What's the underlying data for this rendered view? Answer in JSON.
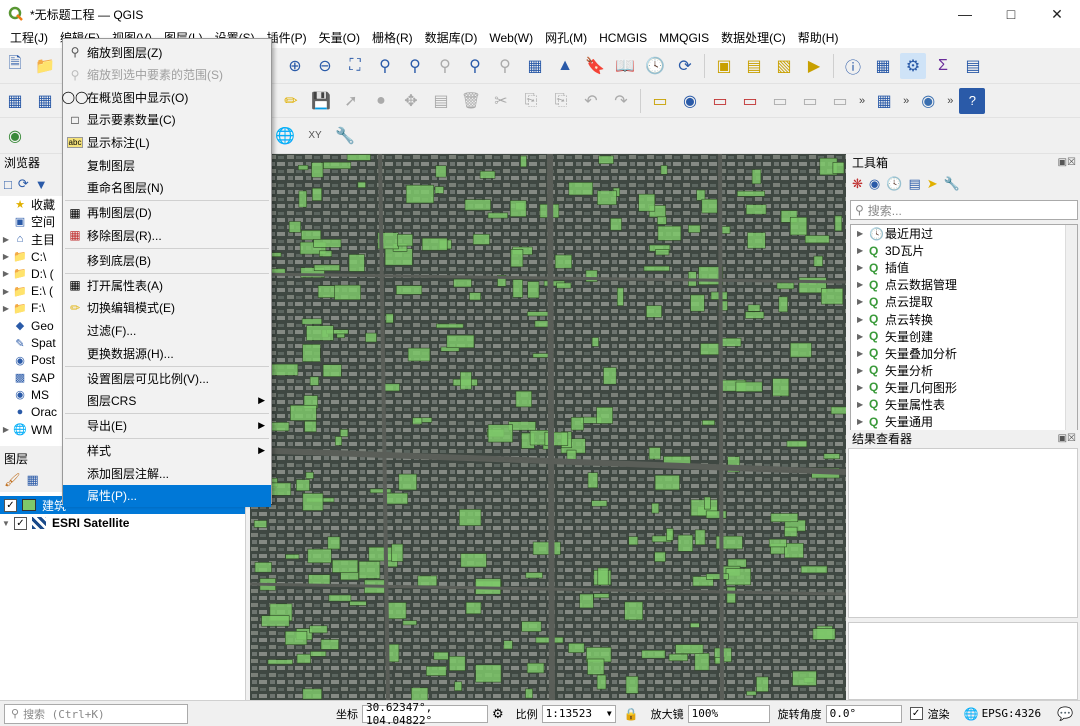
{
  "window": {
    "title": "*无标题工程 — QGIS"
  },
  "menubar": [
    "工程(J)",
    "编辑(E)",
    "视图(V)",
    "图层(L)",
    "设置(S)",
    "插件(P)",
    "矢量(O)",
    "栅格(R)",
    "数据库(D)",
    "Web(W)",
    "网孔(M)",
    "HCMGIS",
    "MMQGIS",
    "数据处理(C)",
    "帮助(H)"
  ],
  "browser": {
    "title": "浏览器",
    "items": [
      {
        "label": "收藏",
        "icon": "star-icon"
      },
      {
        "label": "空间",
        "icon": "bookmark-icon"
      },
      {
        "label": "主目",
        "icon": "home-icon"
      },
      {
        "label": "C:\\",
        "icon": "folder-icon"
      },
      {
        "label": "D:\\ (",
        "icon": "folder-icon"
      },
      {
        "label": "E:\\ (",
        "icon": "folder-icon"
      },
      {
        "label": "F:\\",
        "icon": "folder-icon"
      },
      {
        "label": "Geo",
        "icon": "geopackage-icon"
      },
      {
        "label": "Spat",
        "icon": "spatialite-icon"
      },
      {
        "label": "Post",
        "icon": "postgis-icon"
      },
      {
        "label": "SAP",
        "icon": "sap-icon"
      },
      {
        "label": "MS",
        "icon": "mssql-icon"
      },
      {
        "label": "Orac",
        "icon": "oracle-icon"
      },
      {
        "label": "WM",
        "icon": "wms-icon"
      }
    ]
  },
  "layers": {
    "title": "图层",
    "items": [
      {
        "label": "建筑",
        "checked": true,
        "selected": true
      },
      {
        "label": "ESRI Satellite",
        "checked": true,
        "selected": false
      }
    ]
  },
  "context_menu": [
    {
      "label": "缩放到图层(Z)",
      "icon": "zoom-layer-icon",
      "disabled": false
    },
    {
      "label": "缩放到选中要素的范围(S)",
      "icon": "zoom-selection-icon",
      "disabled": true
    },
    {
      "label": "在概览图中显示(O)",
      "icon": "overview-icon",
      "disabled": false
    },
    {
      "label": "显示要素数量(C)",
      "icon": "checkbox-icon",
      "disabled": false
    },
    {
      "label": "显示标注(L)",
      "icon": "label-icon",
      "disabled": false
    },
    {
      "label": "复制图层",
      "icon": "",
      "disabled": false
    },
    {
      "label": "重命名图层(N)",
      "icon": "",
      "disabled": false,
      "sep_after": true
    },
    {
      "label": "再制图层(D)",
      "icon": "duplicate-layer-icon",
      "disabled": false
    },
    {
      "label": "移除图层(R)...",
      "icon": "remove-layer-icon",
      "disabled": false,
      "sep_after": true
    },
    {
      "label": "移到底层(B)",
      "icon": "",
      "disabled": false,
      "sep_after": true
    },
    {
      "label": "打开属性表(A)",
      "icon": "attribute-table-icon",
      "disabled": false
    },
    {
      "label": "切换编辑模式(E)",
      "icon": "pencil-icon",
      "disabled": false
    },
    {
      "label": "过滤(F)...",
      "icon": "",
      "disabled": false
    },
    {
      "label": "更换数据源(H)...",
      "icon": "",
      "disabled": false,
      "sep_after": true
    },
    {
      "label": "设置图层可见比例(V)...",
      "icon": "",
      "disabled": false
    },
    {
      "label": "图层CRS",
      "icon": "",
      "disabled": false,
      "submenu": true,
      "sep_after": true
    },
    {
      "label": "导出(E)",
      "icon": "",
      "disabled": false,
      "submenu": true,
      "sep_after": true
    },
    {
      "label": "样式",
      "icon": "",
      "disabled": false,
      "submenu": true
    },
    {
      "label": "添加图层注解...",
      "icon": "",
      "disabled": false
    },
    {
      "label": "属性(P)...",
      "icon": "",
      "disabled": false,
      "active": true
    }
  ],
  "toolbox": {
    "title": "工具箱",
    "search_placeholder": "搜索...",
    "items": [
      "最近用过",
      "3D瓦片",
      "插值",
      "点云数据管理",
      "点云提取",
      "点云转换",
      "矢量创建",
      "矢量叠加分析",
      "矢量分析",
      "矢量几何图形",
      "矢量属性表",
      "矢量通用"
    ]
  },
  "results": {
    "title": "结果查看器"
  },
  "statusbar": {
    "search_placeholder": "搜索 (Ctrl+K)",
    "coord_label": "坐标",
    "coord_value": "30.62347°, 104.04822°",
    "scale_label": "比例",
    "scale_value": "1:13523",
    "magnifier_label": "放大镜",
    "magnifier_value": "100%",
    "rotation_label": "旋转角度",
    "rotation_value": "0.0°",
    "render_label": "渲染",
    "crs_value": "EPSG:4326"
  },
  "colors": {
    "accent": "#0078d7",
    "building_fill": "#7ec86a"
  }
}
